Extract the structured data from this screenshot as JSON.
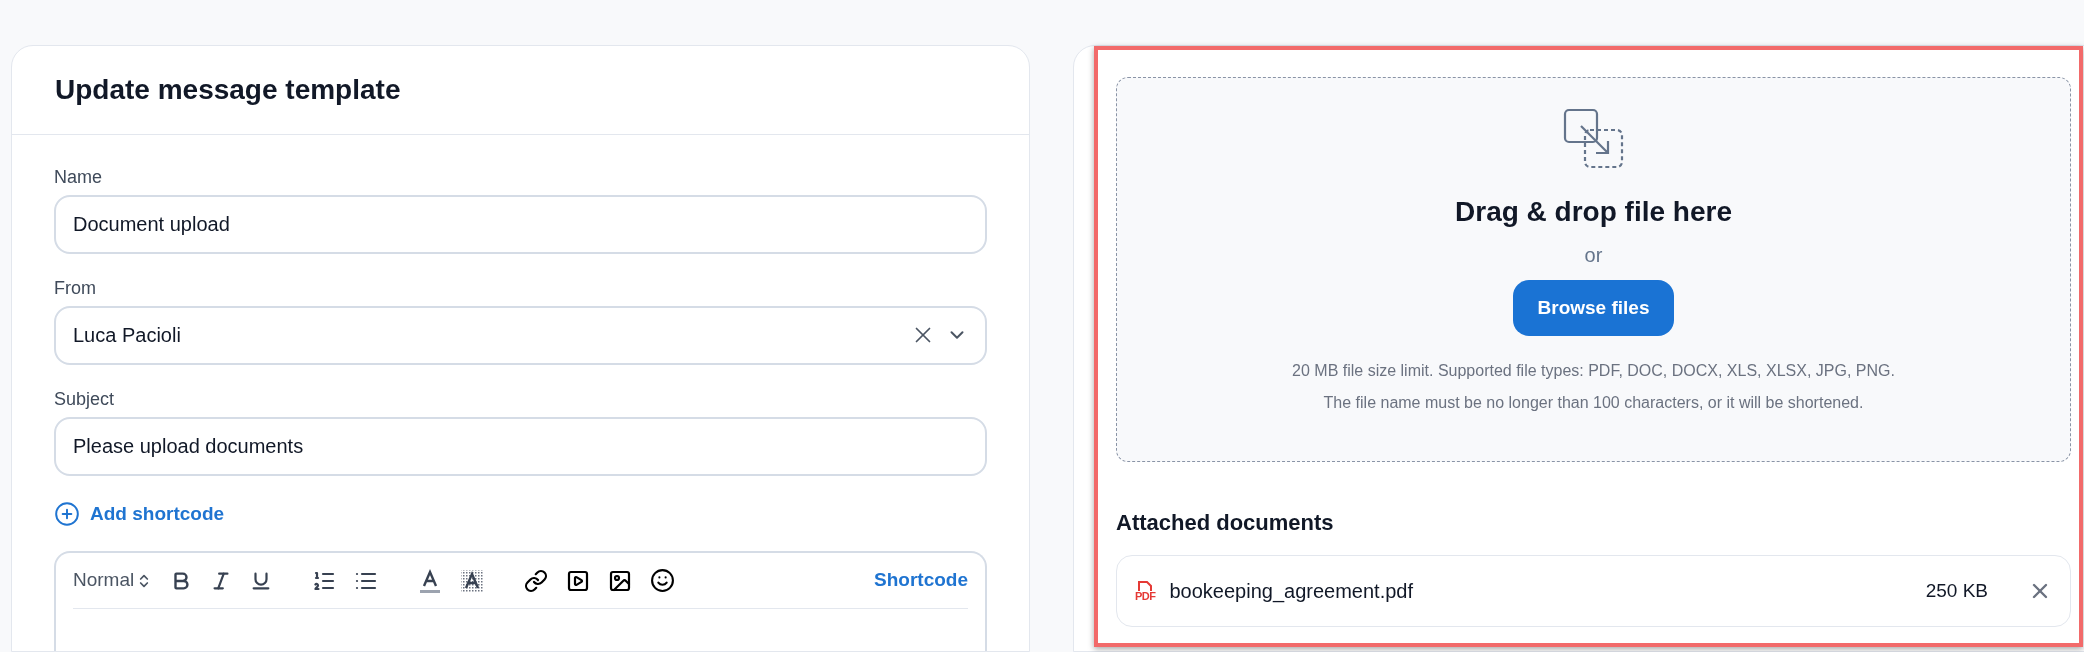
{
  "form_card": {
    "title": "Update message template",
    "fields": [
      {
        "kind": "text",
        "label": "Name",
        "value": "Document upload"
      },
      {
        "kind": "select",
        "label": "From",
        "value": "Luca Pacioli"
      },
      {
        "kind": "text",
        "label": "Subject",
        "value": "Please upload documents"
      }
    ],
    "add_shortcode": "Add shortcode",
    "editor": {
      "format": "Normal",
      "shortcode": "Shortcode"
    }
  },
  "upload_card": {
    "highlighted": true,
    "dropzone": {
      "title": "Drag & drop file here",
      "or": "or",
      "button": "Browse files",
      "hints": [
        "20 MB file size limit. Supported file types: PDF, DOC, DOCX, XLS, XLSX, JPG, PNG.",
        "The file name must be no longer than 100 characters, or it will be shortened."
      ]
    },
    "attached_title": "Attached documents",
    "attachments": [
      {
        "type": "PDF",
        "name": "bookeeping_agreement.pdf",
        "size": "250 KB"
      }
    ]
  }
}
